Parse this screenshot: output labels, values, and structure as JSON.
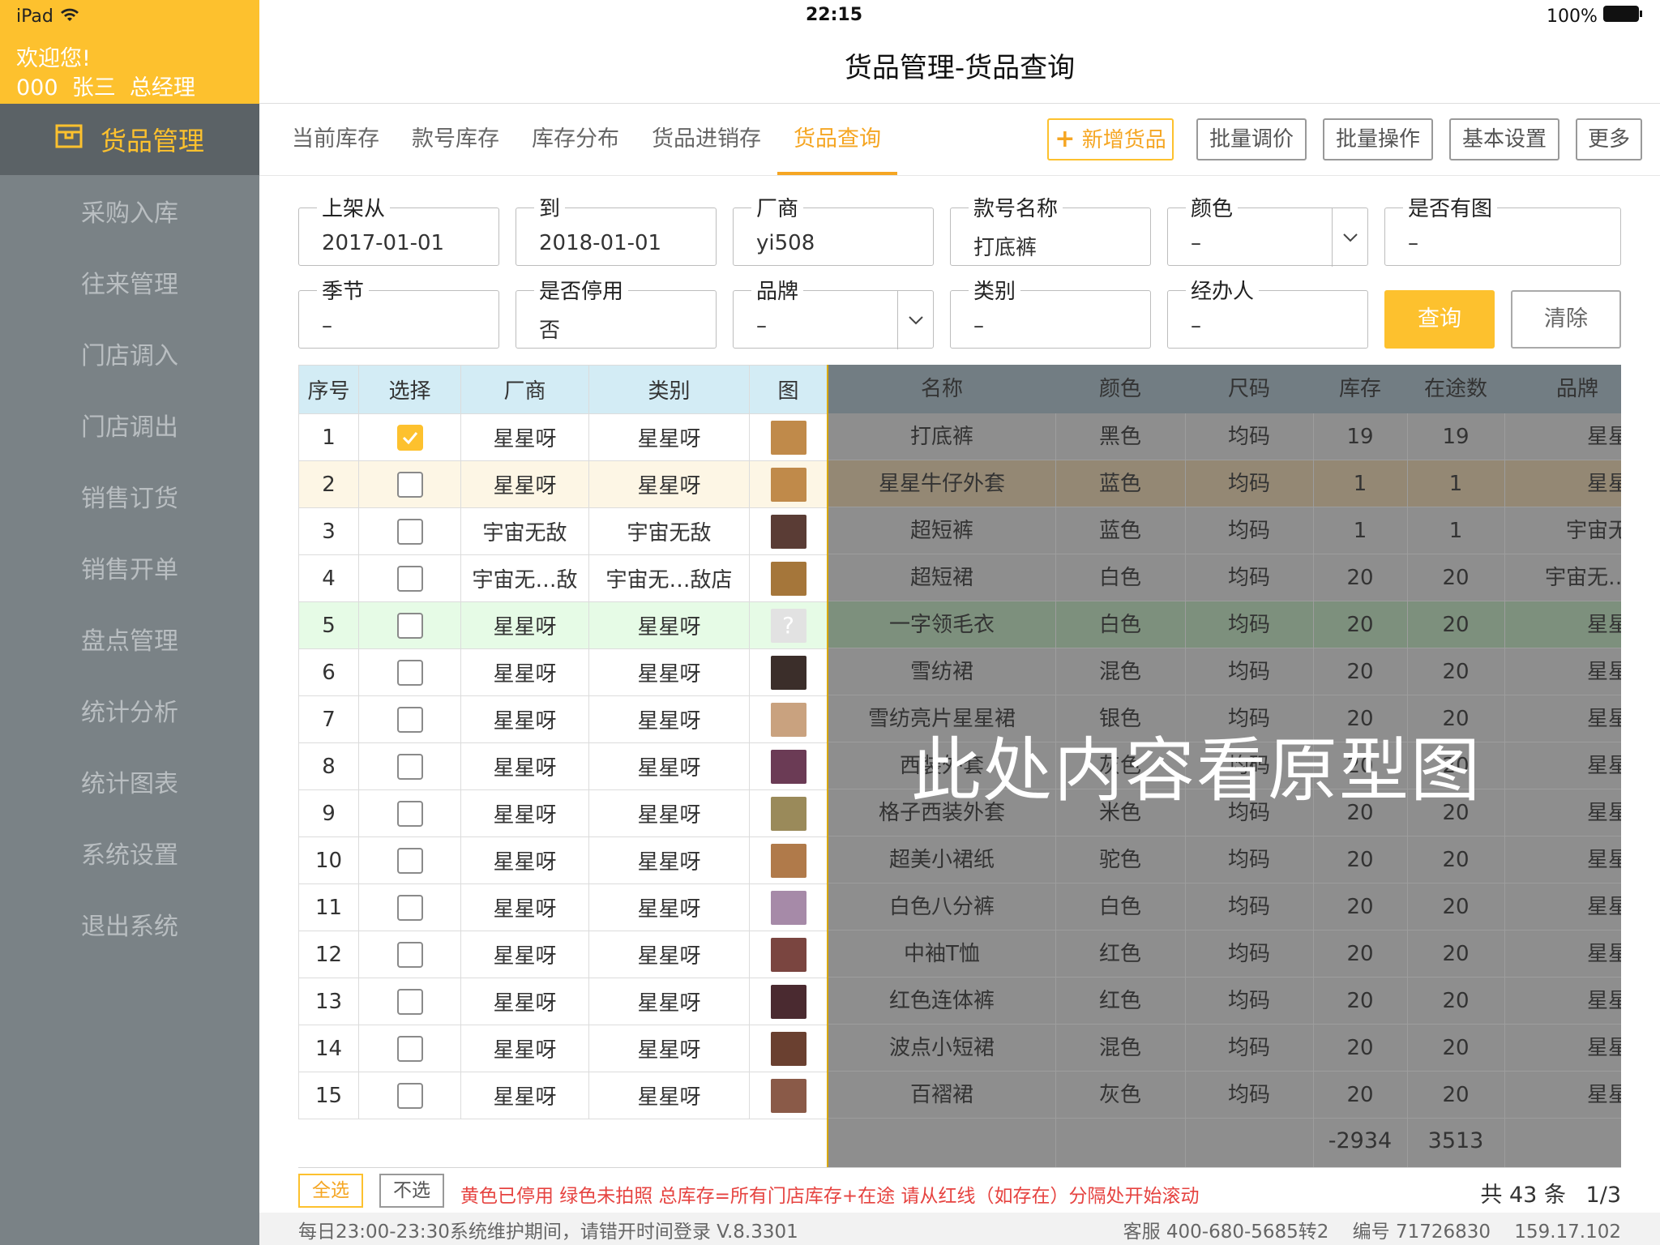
{
  "status_bar": {
    "device": "iPad",
    "time": "22:15",
    "battery": "100%"
  },
  "sidebar": {
    "welcome": "欢迎您!",
    "user": "000  张三  总经理",
    "active_label": "货品管理",
    "items": [
      {
        "label": "采购入库"
      },
      {
        "label": "往来管理"
      },
      {
        "label": "门店调入"
      },
      {
        "label": "门店调出"
      },
      {
        "label": "销售订货"
      },
      {
        "label": "销售开单"
      },
      {
        "label": "盘点管理"
      },
      {
        "label": "统计分析"
      },
      {
        "label": "统计图表"
      },
      {
        "label": "系统设置"
      },
      {
        "label": "退出系统"
      }
    ]
  },
  "header": {
    "title": "货品管理-货品查询"
  },
  "tabs": [
    {
      "label": "当前库存"
    },
    {
      "label": "款号库存"
    },
    {
      "label": "库存分布"
    },
    {
      "label": "货品进销存"
    },
    {
      "label": "货品查询",
      "active": true
    }
  ],
  "actions": {
    "add": "新增货品",
    "batch_price": "批量调价",
    "batch_op": "批量操作",
    "settings": "基本设置",
    "more": "更多"
  },
  "filters": {
    "shelf_from": {
      "label": "上架从",
      "value": "2017-01-01"
    },
    "to": {
      "label": "到",
      "value": "2018-01-01"
    },
    "vendor": {
      "label": "厂商",
      "value": "yi508"
    },
    "style_name": {
      "label": "款号名称",
      "value": "打底裤"
    },
    "color": {
      "label": "颜色",
      "value": "–"
    },
    "has_image": {
      "label": "是否有图",
      "value": "–"
    },
    "season": {
      "label": "季节",
      "value": "–"
    },
    "disabled": {
      "label": "是否停用",
      "value": "否"
    },
    "brand": {
      "label": "品牌",
      "value": "–"
    },
    "category": {
      "label": "类别",
      "value": "–"
    },
    "handler": {
      "label": "经办人",
      "value": "–"
    },
    "query_button": "查询",
    "clear_button": "清除"
  },
  "table": {
    "left_headers": {
      "no": "序号",
      "select": "选择",
      "vendor": "厂商",
      "category": "类别",
      "image": "图"
    },
    "right_headers": {
      "name": "名称",
      "color": "颜色",
      "size": "尺码",
      "stock": "库存",
      "transit": "在途数",
      "brand": "品牌"
    },
    "rows": [
      {
        "no": "1",
        "checked": true,
        "vendor": "星星呀",
        "category": "星星呀",
        "name": "打底裤",
        "color": "黑色",
        "size": "均码",
        "stock": "19",
        "transit": "19",
        "brand": "星星呀",
        "state": "normal",
        "thumb": "#c08a4a"
      },
      {
        "no": "2",
        "checked": false,
        "vendor": "星星呀",
        "category": "星星呀",
        "name": "星星牛仔外套",
        "color": "蓝色",
        "size": "均码",
        "stock": "1",
        "transit": "1",
        "brand": "星星呀",
        "state": "disabled",
        "thumb": "#c08a4a"
      },
      {
        "no": "3",
        "checked": false,
        "vendor": "宇宙无敌",
        "category": "宇宙无敌",
        "name": "超短裤",
        "color": "蓝色",
        "size": "均码",
        "stock": "1",
        "transit": "1",
        "brand": "宇宙无敌",
        "state": "normal",
        "thumb": "#5a3c35"
      },
      {
        "no": "4",
        "checked": false,
        "vendor": "宇宙无…敌",
        "category": "宇宙无…敌店",
        "name": "超短裙",
        "color": "白色",
        "size": "均码",
        "stock": "20",
        "transit": "20",
        "brand": "宇宙无…敌",
        "state": "normal",
        "thumb": "#a5763a"
      },
      {
        "no": "5",
        "checked": false,
        "vendor": "星星呀",
        "category": "星星呀",
        "name": "一字领毛衣",
        "color": "白色",
        "size": "均码",
        "stock": "20",
        "transit": "20",
        "brand": "星星呀",
        "state": "no-photo",
        "thumb": "#e2e2e2"
      },
      {
        "no": "6",
        "checked": false,
        "vendor": "星星呀",
        "category": "星星呀",
        "name": "雪纺裙",
        "color": "混色",
        "size": "均码",
        "stock": "20",
        "transit": "20",
        "brand": "星星呀",
        "state": "normal",
        "thumb": "#3b2e2a"
      },
      {
        "no": "7",
        "checked": false,
        "vendor": "星星呀",
        "category": "星星呀",
        "name": "雪纺亮片星星裙",
        "color": "银色",
        "size": "均码",
        "stock": "20",
        "transit": "20",
        "brand": "星星呀",
        "state": "normal",
        "thumb": "#c9a27f"
      },
      {
        "no": "8",
        "checked": false,
        "vendor": "星星呀",
        "category": "星星呀",
        "name": "西装外套",
        "color": "灰色",
        "size": "均码",
        "stock": "20",
        "transit": "20",
        "brand": "星星呀",
        "state": "normal",
        "thumb": "#6b3b55"
      },
      {
        "no": "9",
        "checked": false,
        "vendor": "星星呀",
        "category": "星星呀",
        "name": "格子西装外套",
        "color": "米色",
        "size": "均码",
        "stock": "20",
        "transit": "20",
        "brand": "星星呀",
        "state": "normal",
        "thumb": "#9a8a5a"
      },
      {
        "no": "10",
        "checked": false,
        "vendor": "星星呀",
        "category": "星星呀",
        "name": "超美小裙纸",
        "color": "驼色",
        "size": "均码",
        "stock": "20",
        "transit": "20",
        "brand": "星星呀",
        "state": "normal",
        "thumb": "#b07a4a"
      },
      {
        "no": "11",
        "checked": false,
        "vendor": "星星呀",
        "category": "星星呀",
        "name": "白色八分裤",
        "color": "白色",
        "size": "均码",
        "stock": "20",
        "transit": "20",
        "brand": "星星呀",
        "state": "normal",
        "thumb": "#a68aa8"
      },
      {
        "no": "12",
        "checked": false,
        "vendor": "星星呀",
        "category": "星星呀",
        "name": "中袖T恤",
        "color": "红色",
        "size": "均码",
        "stock": "20",
        "transit": "20",
        "brand": "星星呀",
        "state": "normal",
        "thumb": "#7a4540"
      },
      {
        "no": "13",
        "checked": false,
        "vendor": "星星呀",
        "category": "星星呀",
        "name": "红色连体裤",
        "color": "红色",
        "size": "均码",
        "stock": "20",
        "transit": "20",
        "brand": "星星呀",
        "state": "normal",
        "thumb": "#4a2a30"
      },
      {
        "no": "14",
        "checked": false,
        "vendor": "星星呀",
        "category": "星星呀",
        "name": "波点小短裙",
        "color": "混色",
        "size": "均码",
        "stock": "20",
        "transit": "20",
        "brand": "星星呀",
        "state": "normal",
        "thumb": "#6a4030"
      },
      {
        "no": "15",
        "checked": false,
        "vendor": "星星呀",
        "category": "星星呀",
        "name": "百褶裙",
        "color": "灰色",
        "size": "均码",
        "stock": "20",
        "transit": "20",
        "brand": "星星呀",
        "state": "normal",
        "thumb": "#8a5a48"
      }
    ],
    "totals": {
      "stock": "-2934",
      "transit": "3513"
    },
    "overlay_text": "此处内容看原型图"
  },
  "footer": {
    "select_all": "全选",
    "select_none": "不选",
    "legend": "黄色已停用  绿色未拍照  总库存=所有门店库存+在途  请从红线（如存在）分隔处开始滚动",
    "total_count": "共 43 条",
    "page": "1/3",
    "maintenance": "每日23:00-23:30系统维护期间，请错开时间登录 V.8.3301",
    "service": "客服 400-680-5685转2    编号 71726830    159.17.102"
  },
  "colors": {
    "accent": "#fdc12e",
    "sidebar": "#7a8286",
    "sidebar_active": "#5b6266",
    "legend_red": "#e64340"
  }
}
